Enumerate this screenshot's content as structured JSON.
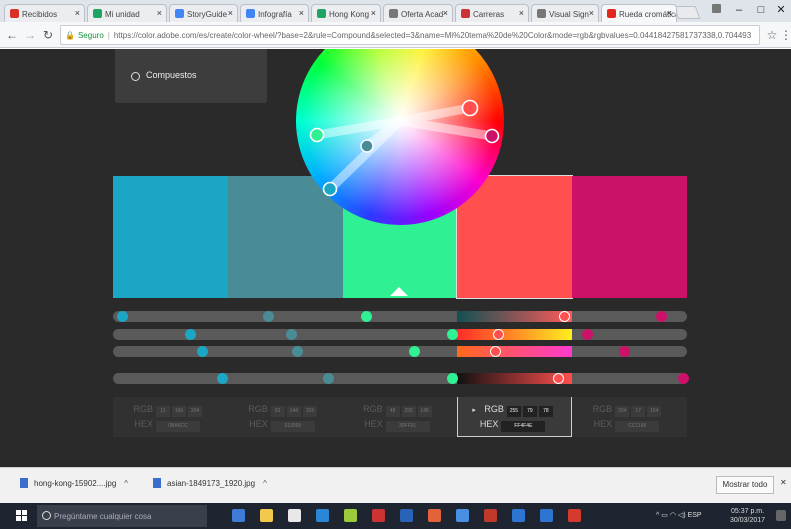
{
  "browser": {
    "tabs": [
      {
        "title": "Recibidos",
        "color": "#d93025"
      },
      {
        "title": "Mi unidad",
        "color": "#1fa463"
      },
      {
        "title": "StoryGuide",
        "color": "#4285f4"
      },
      {
        "title": "Infografía",
        "color": "#4285f4"
      },
      {
        "title": "Hong Kong",
        "color": "#1fa463"
      },
      {
        "title": "Oferta Acad",
        "color": "#777777"
      },
      {
        "title": "Carreras",
        "color": "#cc3333"
      },
      {
        "title": "Visual Sign",
        "color": "#777777"
      },
      {
        "title": "Rueda cromática",
        "color": "#e0281c"
      }
    ],
    "url_secure_label": "Seguro",
    "url": "https://color.adobe.com/es/create/color-wheel/?base=2&rule=Compound&selected=3&name=Mi%20tema%20de%20Color&mode=rgb&rgbvalues=0.04418427581737338,0.704493",
    "window_controls": {
      "minimize": "–",
      "maximize": "□",
      "close": "✕"
    }
  },
  "colorwheel": {
    "rule_option": "Compuestos",
    "swatches": [
      {
        "color": "#1ba6c6",
        "selected": false
      },
      {
        "color": "#4a8c95",
        "selected": false
      },
      {
        "color": "#2ff093",
        "selected": false
      },
      {
        "color": "#ff4f4e",
        "selected": true
      },
      {
        "color": "#cc1168",
        "selected": false
      }
    ],
    "sliders": [
      {
        "dots": [
          {
            "p": 0.015,
            "c": "#1ba6c6"
          },
          {
            "p": 0.27,
            "c": "#4a8c95"
          },
          {
            "p": 0.44,
            "c": "#2ff093"
          },
          {
            "p": 0.785,
            "c": "#ff4f4e"
          },
          {
            "p": 0.955,
            "c": "#cc1168"
          }
        ],
        "selected_gradient": [
          "#115054",
          "#ff5a5a"
        ]
      },
      {
        "dots": [
          {
            "p": 0.135,
            "c": "#1ba6c6"
          },
          {
            "p": 0.31,
            "c": "#4a8c95"
          },
          {
            "p": 0.59,
            "c": "#2ff093"
          },
          {
            "p": 0.67,
            "c": "#ff4f4e"
          },
          {
            "p": 0.825,
            "c": "#cc1168"
          }
        ],
        "selected_gradient": [
          "#ff2a2a",
          "#ffee20"
        ]
      },
      {
        "dots": [
          {
            "p": 0.155,
            "c": "#1ba6c6"
          },
          {
            "p": 0.32,
            "c": "#4a8c95"
          },
          {
            "p": 0.525,
            "c": "#2ff093"
          },
          {
            "p": 0.665,
            "c": "#ff4f4e"
          },
          {
            "p": 0.89,
            "c": "#cc1168"
          }
        ],
        "selected_gradient": [
          "#ff6a1a",
          "#ff3ad0"
        ]
      },
      {
        "dots": [
          {
            "p": 0.19,
            "c": "#1ba6c6"
          },
          {
            "p": 0.375,
            "c": "#4a8c95"
          },
          {
            "p": 0.59,
            "c": "#2ff093"
          },
          {
            "p": 0.775,
            "c": "#ff4f4e"
          },
          {
            "p": 0.993,
            "c": "#cc1168"
          }
        ],
        "selected_gradient": [
          "#111111",
          "#ff4f4e"
        ]
      }
    ],
    "values": [
      {
        "rgb_label": "RGB",
        "r": "11",
        "g": "166",
        "b": "204",
        "hex_label": "HEX",
        "hex": "0BA6CC",
        "selected": false
      },
      {
        "rgb_label": "RGB",
        "r": "81",
        "g": "144",
        "b": "153",
        "hex_label": "HEX",
        "hex": "519099",
        "selected": false
      },
      {
        "rgb_label": "RGB",
        "r": "48",
        "g": "255",
        "b": "145",
        "hex_label": "HEX",
        "hex": "30FF91",
        "selected": false
      },
      {
        "rgb_label": "RGB",
        "r": "255",
        "g": "79",
        "b": "78",
        "hex_label": "HEX",
        "hex": "FF4F4E",
        "selected": true
      },
      {
        "rgb_label": "RGB",
        "r": "204",
        "g": "17",
        "b": "104",
        "hex_label": "HEX",
        "hex": "CC1168",
        "selected": false
      }
    ]
  },
  "downloads": {
    "items": [
      {
        "name": "hong-kong-15902....jpg"
      },
      {
        "name": "asian-1849173_1920.jpg"
      }
    ],
    "show_all": "Mostrar todo",
    "close": "✕"
  },
  "taskbar": {
    "search_placeholder": "Pregúntame cualquier cosa",
    "apps": [
      "#3f7bd6",
      "#f2c94c",
      "#e8e8e8",
      "#2c86d8",
      "#9ccc3c",
      "#cc3333",
      "#2a62b8",
      "#e2623a",
      "#4a90e2",
      "#c0392b",
      "#2e75d1",
      "#2e75d1",
      "#d53b2d"
    ],
    "tray_lang": "ESP",
    "time": "05:37 p.m.",
    "date": "30/03/2017"
  }
}
